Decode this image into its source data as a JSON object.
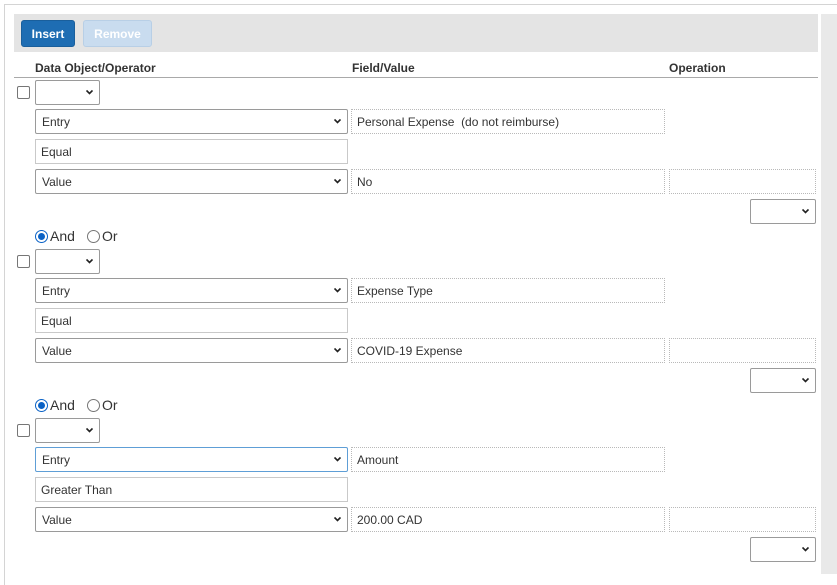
{
  "toolbar": {
    "insert_label": "Insert",
    "remove_label": "Remove"
  },
  "columns": {
    "data_object": "Data Object/Operator",
    "field_value": "Field/Value",
    "operation": "Operation"
  },
  "logic": {
    "and_label": "And",
    "or_label": "Or"
  },
  "conditions": [
    {
      "group_select": "",
      "left_object": "Entry",
      "left_field": "Personal Expense  (do not reimburse)",
      "operator": "Equal",
      "right_object": "Value",
      "right_value": "No",
      "operation": "",
      "connector_select": ""
    },
    {
      "connector": "And",
      "group_select": "",
      "left_object": "Entry",
      "left_field": "Expense Type",
      "operator": "Equal",
      "right_object": "Value",
      "right_value": "COVID-19 Expense",
      "operation": "",
      "connector_select": ""
    },
    {
      "connector": "And",
      "group_select": "",
      "left_object": "Entry",
      "left_field": "Amount",
      "operator": "Greater Than",
      "right_object": "Value",
      "right_value": "200.00 CAD",
      "operation": "",
      "connector_select": ""
    }
  ],
  "icons": {
    "dropdown": "chevron-down-icon"
  }
}
